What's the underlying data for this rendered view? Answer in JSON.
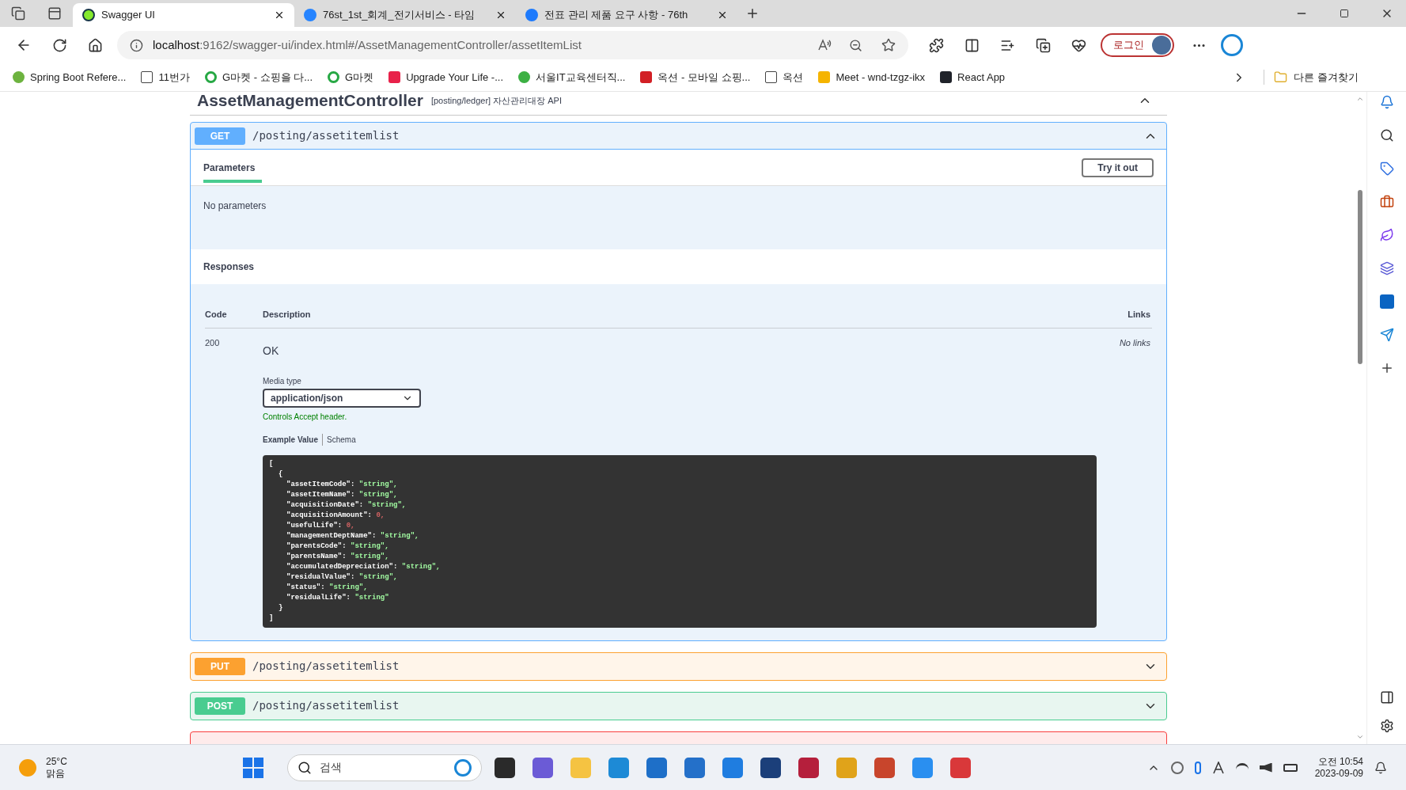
{
  "browser": {
    "tabs": [
      {
        "title": "Swagger UI",
        "selected": true
      },
      {
        "title": "76st_1st_회계_전기서비스 - 타임",
        "selected": false
      },
      {
        "title": "전표 관리 제품 요구 사항 - 76th",
        "selected": false
      }
    ],
    "url_host": "localhost",
    "url_rest": ":9162/swagger-ui/index.html#/AssetManagementController/assetItemList",
    "login": "로그인"
  },
  "bookmarks": [
    "Spring Boot Refere...",
    "11번가",
    "G마켓 - 쇼핑을 다...",
    "G마켓",
    "Upgrade Your Life -...",
    "서울IT교육센터직...",
    "옥션 - 모바일 쇼핑...",
    "옥션",
    "Meet - wnd-tzgz-ikx",
    "React App"
  ],
  "other_favorites": "다른 즐겨찾기",
  "controller": {
    "name": "AssetManagementController",
    "tag": "[posting/ledger] 자산관리대장 API"
  },
  "operations": [
    {
      "method": "GET",
      "path": "/posting/assetitemlist",
      "expanded": true
    },
    {
      "method": "PUT",
      "path": "/posting/assetitemlist",
      "expanded": false
    },
    {
      "method": "POST",
      "path": "/posting/assetitemlist",
      "expanded": false
    }
  ],
  "details": {
    "parameters_tab": "Parameters",
    "try_button": "Try it out",
    "no_params": "No parameters",
    "responses_title": "Responses",
    "columns": [
      "Code",
      "Description",
      "Links"
    ],
    "response": {
      "code": "200",
      "description": "OK",
      "links": "No links",
      "media_label": "Media type",
      "media_type": "application/json",
      "media_note": "Controls Accept header.",
      "example_tabs": [
        {
          "label": "Example Value",
          "selected": true
        },
        {
          "label": "Schema",
          "selected": false
        }
      ],
      "open": "[",
      "open_obj": "{",
      "close_obj": "}",
      "close": "]",
      "fields": [
        {
          "key": "\"assetItemCode\": ",
          "value": "\"string\",",
          "kind": "string"
        },
        {
          "key": "\"assetItemName\": ",
          "value": "\"string\",",
          "kind": "string"
        },
        {
          "key": "\"acquisitionDate\": ",
          "value": "\"string\",",
          "kind": "string"
        },
        {
          "key": "\"acquisitionAmount\": ",
          "value": "0,",
          "kind": "number"
        },
        {
          "key": "\"usefulLife\": ",
          "value": "0,",
          "kind": "number"
        },
        {
          "key": "\"managementDeptName\": ",
          "value": "\"string\",",
          "kind": "string"
        },
        {
          "key": "\"parentsCode\": ",
          "value": "\"string\",",
          "kind": "string"
        },
        {
          "key": "\"parentsName\": ",
          "value": "\"string\",",
          "kind": "string"
        },
        {
          "key": "\"accumulatedDepreciation\": ",
          "value": "\"string\",",
          "kind": "string"
        },
        {
          "key": "\"residualValue\": ",
          "value": "\"string\",",
          "kind": "string"
        },
        {
          "key": "\"status\": ",
          "value": "\"string\",",
          "kind": "string"
        },
        {
          "key": "\"residualLife\": ",
          "value": "\"string\"",
          "kind": "string"
        }
      ]
    }
  },
  "taskbar": {
    "temperature": "25°C",
    "weather": "맑음",
    "search": "검색",
    "time": "오전 10:54",
    "date": "2023-09-09"
  }
}
